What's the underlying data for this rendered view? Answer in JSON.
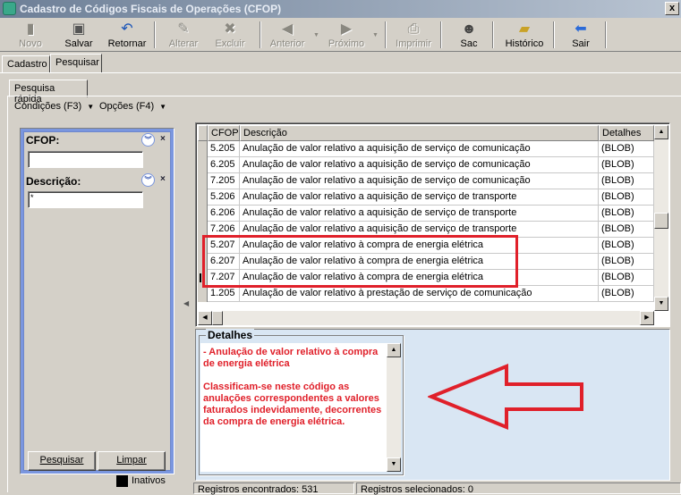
{
  "window": {
    "title": "Cadastro de Códigos Fiscais de Operações (CFOP)",
    "close_glyph": "x"
  },
  "toolbar": {
    "novo": "Novo",
    "salvar": "Salvar",
    "retornar": "Retornar",
    "alterar": "Alterar",
    "excluir": "Excluir",
    "anterior": "Anterior",
    "proximo": "Próximo",
    "imprimir": "Imprimir",
    "sac": "Sac",
    "historico": "Histórico",
    "sair": "Sair"
  },
  "tabs": {
    "cadastro": "Cadastro",
    "pesquisar": "Pesquisar",
    "pesquisa_rapida": "Pesquisa rápida"
  },
  "menu": {
    "condicoes": "Condições (F3)",
    "opcoes": "Opções (F4)"
  },
  "filter": {
    "cfop_label": "CFOP:",
    "cfop_value": "",
    "descricao_label": "Descrição:",
    "descricao_value": "*",
    "pesquisar_button": "Pesquisar",
    "limpar_button": "Limpar",
    "inativos_label": "Inativos"
  },
  "grid": {
    "columns": [
      "CFOP",
      "Descrição",
      "Detalhes"
    ],
    "rows": [
      {
        "cfop": "5.205",
        "descricao": "Anulação de valor relativo a aquisição de serviço de comunicação",
        "detalhes": "(BLOB)"
      },
      {
        "cfop": "6.205",
        "descricao": "Anulação de valor relativo a aquisição de serviço de comunicação",
        "detalhes": "(BLOB)"
      },
      {
        "cfop": "7.205",
        "descricao": "Anulação de valor relativo a aquisição de serviço de comunicação",
        "detalhes": "(BLOB)"
      },
      {
        "cfop": "5.206",
        "descricao": "Anulação de valor relativo a aquisição de serviço de transporte",
        "detalhes": "(BLOB)"
      },
      {
        "cfop": "6.206",
        "descricao": "Anulação de valor relativo a aquisição de serviço de transporte",
        "detalhes": "(BLOB)"
      },
      {
        "cfop": "7.206",
        "descricao": "Anulação de valor relativo a aquisição de serviço de transporte",
        "detalhes": "(BLOB)"
      },
      {
        "cfop": "5.207",
        "descricao": "Anulação de valor relativo à compra de energia elétrica",
        "detalhes": "(BLOB)"
      },
      {
        "cfop": "6.207",
        "descricao": "Anulação de valor relativo à compra de energia elétrica",
        "detalhes": "(BLOB)"
      },
      {
        "cfop": "7.207",
        "descricao": "Anulação de valor relativo à compra de energia elétrica",
        "detalhes": "(BLOB)"
      },
      {
        "cfop": "1.205",
        "descricao": "Anulação de valor relativo à prestação de serviço de comunicação",
        "detalhes": "(BLOB)"
      }
    ],
    "current_row_cfop": "7.207"
  },
  "details": {
    "label": "Detalhes",
    "text": "- Anulação de valor relativo à compra de energia elétrica\n\nClassificam-se neste código as anulações correspondentes a valores faturados indevidamente, decorrentes da compra de energia elétrica."
  },
  "status": {
    "registros_encontrados": "Registros encontrados: 531",
    "registros_selecionados": "Registros selecionados: 0"
  },
  "colors": {
    "highlight": "#e0202a",
    "filter_panel": "#7a96df",
    "details_bg": "#d9e6f3"
  }
}
